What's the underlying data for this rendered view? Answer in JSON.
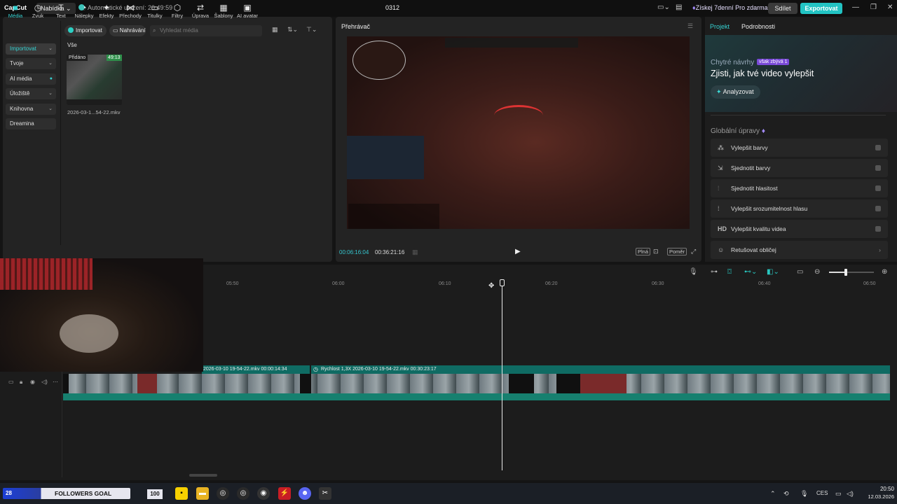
{
  "titlebar": {
    "app_name": "CapCut",
    "menu_label": "Nabídka",
    "autosave": "Automatické uložení: 20:49:59",
    "project_name": "0312",
    "promo": "Získej 7denní Pro zdarma",
    "share_label": "Sdílet",
    "export_label": "Exportovat"
  },
  "toolbar": {
    "tools": [
      {
        "label": "Média",
        "icon": "media-icon"
      },
      {
        "label": "Zvuk",
        "icon": "audio-icon"
      },
      {
        "label": "Text",
        "icon": "text-icon"
      },
      {
        "label": "Nálepky",
        "icon": "sticker-icon"
      },
      {
        "label": "Efekty",
        "icon": "effects-icon"
      },
      {
        "label": "Přechody",
        "icon": "transitions-icon"
      },
      {
        "label": "Titulky",
        "icon": "captions-icon"
      },
      {
        "label": "Filtry",
        "icon": "filters-icon"
      },
      {
        "label": "Úprava",
        "icon": "adjust-icon"
      },
      {
        "label": "Šablony",
        "icon": "templates-icon"
      },
      {
        "label": "AI avatar",
        "icon": "avatar-icon"
      }
    ]
  },
  "media": {
    "nav": [
      "Importovat",
      "Tvoje",
      "AI média",
      "Úložiště",
      "Knihovna",
      "Dreamina"
    ],
    "import_label": "Importovat",
    "record_label": "Nahrávání",
    "search_placeholder": "Vyhledat média",
    "section_label": "Vše",
    "clip": {
      "added": "Přidáno",
      "duration": "49:13",
      "name": "2026-03-1...54-22.mkv"
    }
  },
  "player": {
    "title": "Přehrávač",
    "current_time": "00:06:16:04",
    "total_time": "00:36:21:16",
    "full_label": "Plná",
    "ratio_label": "Poměr"
  },
  "right_panel": {
    "tabs": [
      "Projekt",
      "Podrobnosti"
    ],
    "smart_label": "Chytré návrhy",
    "smart_badge": "však zbývá 1",
    "smart_title": "Zjisti, jak tvé video vylepšit",
    "analyze_label": "Analyzovat",
    "global_title": "Globální úpravy",
    "options": [
      {
        "label": "Vylepšit barvy",
        "icon": "enhance-color-icon"
      },
      {
        "label": "Sjednotit barvy",
        "icon": "unify-color-icon"
      },
      {
        "label": "Sjednotit hlasitost",
        "icon": "volume-icon"
      },
      {
        "label": "Vylepšit srozumitelnost hlasu",
        "icon": "voice-icon"
      },
      {
        "label": "Vylepšit kvalitu videa",
        "icon": "hd-icon"
      },
      {
        "label": "Retušovat obličej",
        "icon": "face-icon"
      }
    ]
  },
  "timeline": {
    "ruler": [
      "05:50",
      "06:00",
      "06:10",
      "06:20",
      "06:30",
      "06:40",
      "06:50"
    ],
    "clip1": "2026-03-10 19-54-22.mkv  00:00:14:34",
    "clip2": "Rychlost 1,3X   2026-03-10 19-54-22.mkv   00:30:23:17"
  },
  "taskbar": {
    "goal_count": "28",
    "goal_text": "FOLLOWERS GOAL",
    "goal_target": "100",
    "lang": "CES",
    "time": "20:50",
    "date": "12.03.2026"
  }
}
